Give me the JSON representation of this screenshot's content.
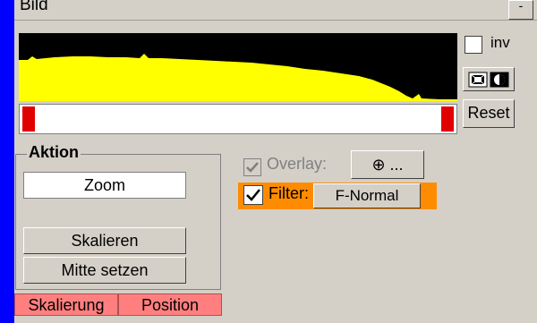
{
  "panel": {
    "title": "Bild",
    "collapse_label": "-"
  },
  "histogram": {
    "background": "#000000",
    "fill": "#ffff00",
    "slider_handle_color": "#e00000"
  },
  "controls": {
    "inv_label": "inv",
    "inv_checked": false,
    "invert_icon": "pattern-contrast-icons",
    "reset_label": "Reset"
  },
  "aktion": {
    "legend": "Aktion",
    "mode_value": "Zoom",
    "skalieren_label": "Skalieren",
    "mitte_label": "Mitte setzen"
  },
  "tabs": [
    {
      "label": "Skalierung"
    },
    {
      "label": "Position"
    }
  ],
  "overlay": {
    "label": "Overlay:",
    "checked": true,
    "enabled": false,
    "button_label": "⊕ ..."
  },
  "filter": {
    "label": "Filter:",
    "checked": true,
    "button_label": "F-Normal",
    "highlight_color": "#ff8c00"
  }
}
